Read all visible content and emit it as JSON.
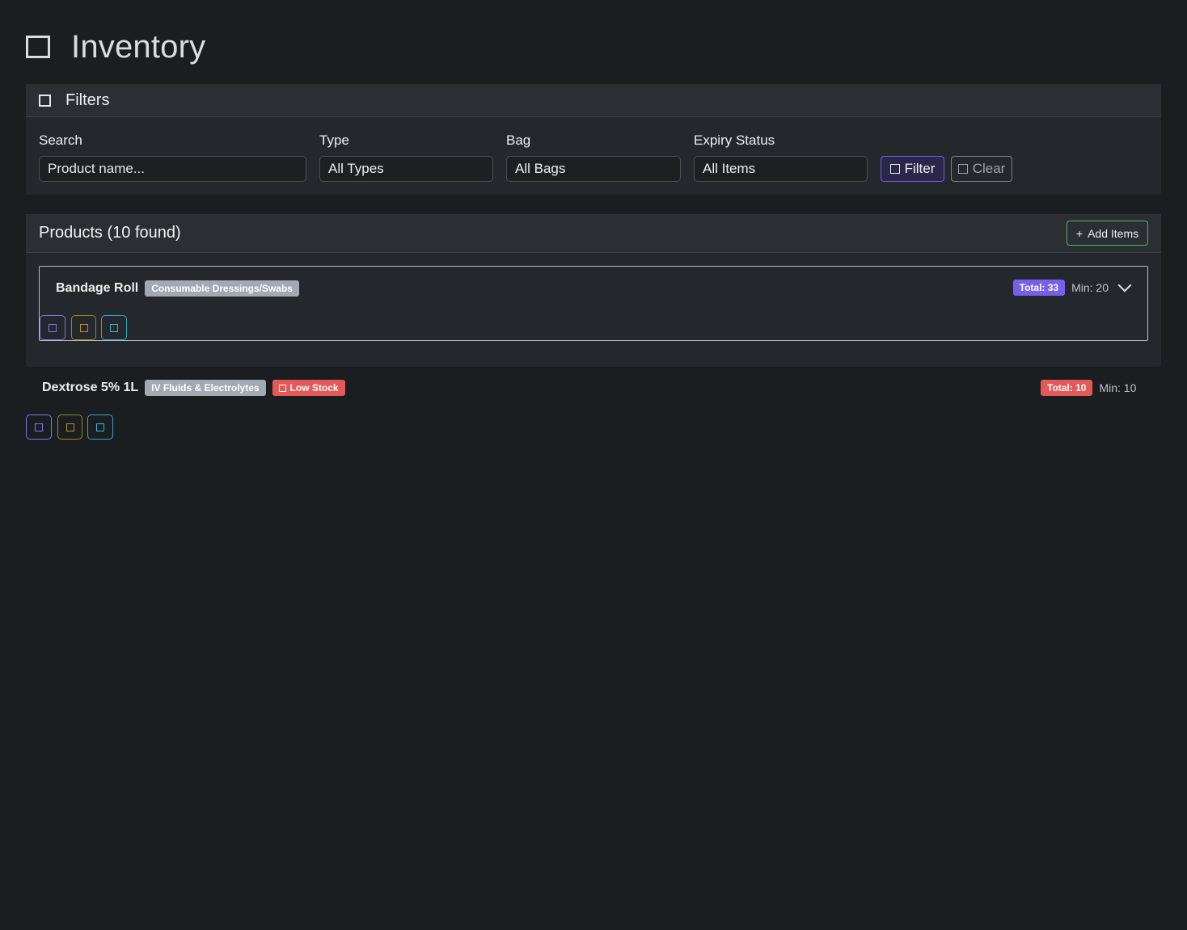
{
  "page": {
    "title": "Inventory",
    "title_icon": "box-icon"
  },
  "filters": {
    "title": "Filters",
    "title_icon": "filter-icon",
    "search_label": "Search",
    "search_placeholder": "Product name...",
    "type_label": "Type",
    "type_value": "All Types",
    "bag_label": "Bag",
    "bag_value": "All Bags",
    "expiry_label": "Expiry Status",
    "expiry_value": "All Items",
    "filter_button": "Filter",
    "clear_button": "Clear"
  },
  "products": {
    "title": "Products (10 found)",
    "add_button": "Add Items",
    "items": [
      {
        "name": "Bandage Roll",
        "category": "Consumable Dressings/Swabs",
        "total": "Total: 33",
        "total_color": "#7660ea",
        "min": "Min: 20",
        "expanded_toggle": "chevron-down-icon"
      },
      {
        "name": "Dextrose 5% 1L",
        "category": "IV Fluids & Electrolytes",
        "alert": "Low Stock",
        "total": "Total: 10",
        "total_color": "#e55858",
        "min": "Min: 10"
      }
    ]
  },
  "colors": {
    "background": "#1b1e21",
    "card": "#24282c",
    "accent_purple": "#6f5de0",
    "accent_green": "#4fb26d",
    "danger": "#e55858"
  }
}
